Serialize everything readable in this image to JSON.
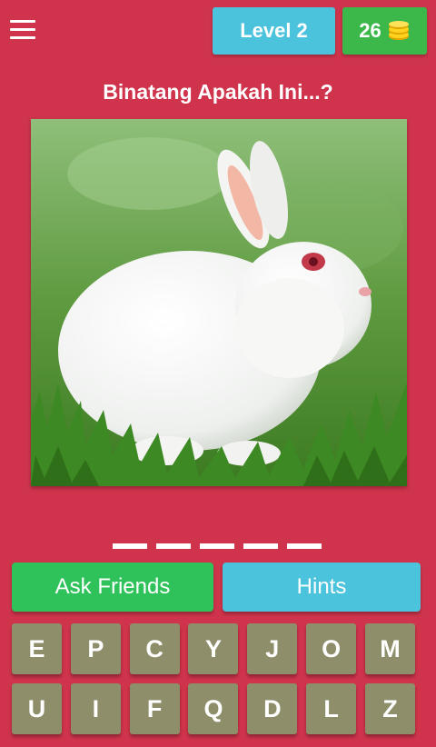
{
  "header": {
    "menu_icon": "hamburger-menu-icon",
    "level_label": "Level 2",
    "coins": "26",
    "coin_icon": "coin-stack-icon"
  },
  "question": "Binatang Apakah Ini...?",
  "answer_slot_count": 5,
  "buttons": {
    "ask_friends": "Ask Friends",
    "hints": "Hints"
  },
  "keyboard": {
    "row1": [
      "E",
      "P",
      "C",
      "Y",
      "J",
      "O",
      "M"
    ],
    "row2": [
      "U",
      "I",
      "F",
      "Q",
      "D",
      "L",
      "Z"
    ]
  },
  "colors": {
    "background": "#cf344c",
    "level_badge": "#4cc3dc",
    "coins_badge": "#3cb84a",
    "ask_button": "#2fc25a",
    "hints_button": "#4cc3dc",
    "key": "#8e8e6a"
  }
}
